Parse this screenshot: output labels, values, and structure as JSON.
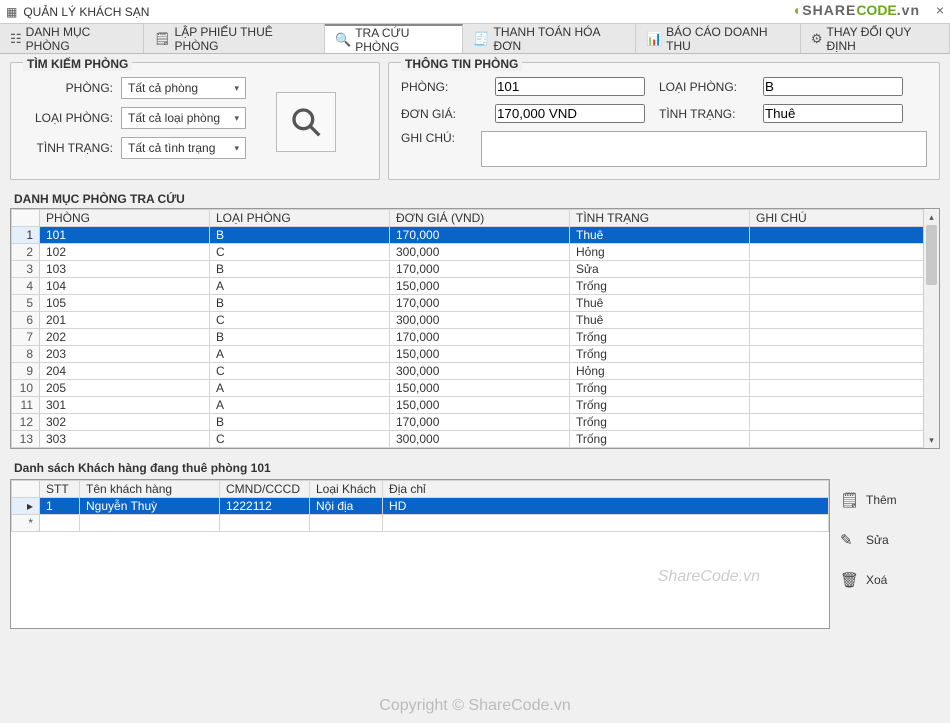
{
  "window_title": "QUẢN LÝ KHÁCH SẠN",
  "tabs": [
    {
      "label": "DANH MỤC PHÒNG"
    },
    {
      "label": "LẬP PHIẾU THUÊ PHÒNG"
    },
    {
      "label": "TRA CỨU PHÒNG"
    },
    {
      "label": "THANH TOÁN HÓA ĐƠN"
    },
    {
      "label": "BÁO CÁO DOANH THU"
    },
    {
      "label": "THAY ĐỔI QUY ĐỊNH"
    }
  ],
  "search": {
    "legend": "TÌM KIẾM PHÒNG",
    "room_label": "PHÒNG:",
    "room_value": "Tất cả phòng",
    "type_label": "LOẠI PHÒNG:",
    "type_value": "Tất cả loại phòng",
    "status_label": "TÌNH TRẠNG:",
    "status_value": "Tất cả tình trạng"
  },
  "info": {
    "legend": "THÔNG TIN PHÒNG",
    "room_label": "PHÒNG:",
    "room_value": "101",
    "type_label": "LOẠI PHÒNG:",
    "type_value": "B",
    "price_label": "ĐƠN GIÁ:",
    "price_value": "170,000 VND",
    "status_label": "TÌNH TRẠNG:",
    "status_value": "Thuê",
    "note_label": "GHI CHÚ:",
    "note_value": ""
  },
  "rooms_title": "DANH MỤC PHÒNG TRA CỨU",
  "rooms_cols": [
    "PHÒNG",
    "LOẠI PHÒNG",
    "ĐƠN GIÁ (VND)",
    "TÌNH TRẠNG",
    "GHI CHÚ"
  ],
  "rooms": [
    {
      "n": "1",
      "p": "101",
      "l": "B",
      "g": "170,000",
      "t": "Thuê",
      "c": ""
    },
    {
      "n": "2",
      "p": "102",
      "l": "C",
      "g": "300,000",
      "t": "Hỏng",
      "c": ""
    },
    {
      "n": "3",
      "p": "103",
      "l": "B",
      "g": "170,000",
      "t": "Sửa",
      "c": ""
    },
    {
      "n": "4",
      "p": "104",
      "l": "A",
      "g": "150,000",
      "t": "Trống",
      "c": ""
    },
    {
      "n": "5",
      "p": "105",
      "l": "B",
      "g": "170,000",
      "t": "Thuê",
      "c": ""
    },
    {
      "n": "6",
      "p": "201",
      "l": "C",
      "g": "300,000",
      "t": "Thuê",
      "c": ""
    },
    {
      "n": "7",
      "p": "202",
      "l": "B",
      "g": "170,000",
      "t": "Trống",
      "c": ""
    },
    {
      "n": "8",
      "p": "203",
      "l": "A",
      "g": "150,000",
      "t": "Trống",
      "c": ""
    },
    {
      "n": "9",
      "p": "204",
      "l": "C",
      "g": "300,000",
      "t": "Hỏng",
      "c": ""
    },
    {
      "n": "10",
      "p": "205",
      "l": "A",
      "g": "150,000",
      "t": "Trống",
      "c": ""
    },
    {
      "n": "11",
      "p": "301",
      "l": "A",
      "g": "150,000",
      "t": "Trống",
      "c": ""
    },
    {
      "n": "12",
      "p": "302",
      "l": "B",
      "g": "170,000",
      "t": "Trống",
      "c": ""
    },
    {
      "n": "13",
      "p": "303",
      "l": "C",
      "g": "300,000",
      "t": "Trống",
      "c": ""
    }
  ],
  "cust_title": "Danh sách Khách hàng đang thuê phòng 101",
  "cust_cols": [
    "STT",
    "Tên khách hàng",
    "CMND/CCCD",
    "Loại Khách",
    "Địa chỉ"
  ],
  "customers": [
    {
      "stt": "1",
      "ten": "Nguyễn Thuỳ",
      "cmnd": "1222112",
      "loai": "Nội địa",
      "dc": "HD"
    }
  ],
  "actions": {
    "add": "Thêm",
    "edit": "Sửa",
    "del": "Xoá"
  },
  "watermark": {
    "logo1": "SHARE",
    "logo2": "CODE",
    "logo3": ".vn",
    "center": "ShareCode.vn",
    "copyright": "Copyright © ShareCode.vn"
  }
}
